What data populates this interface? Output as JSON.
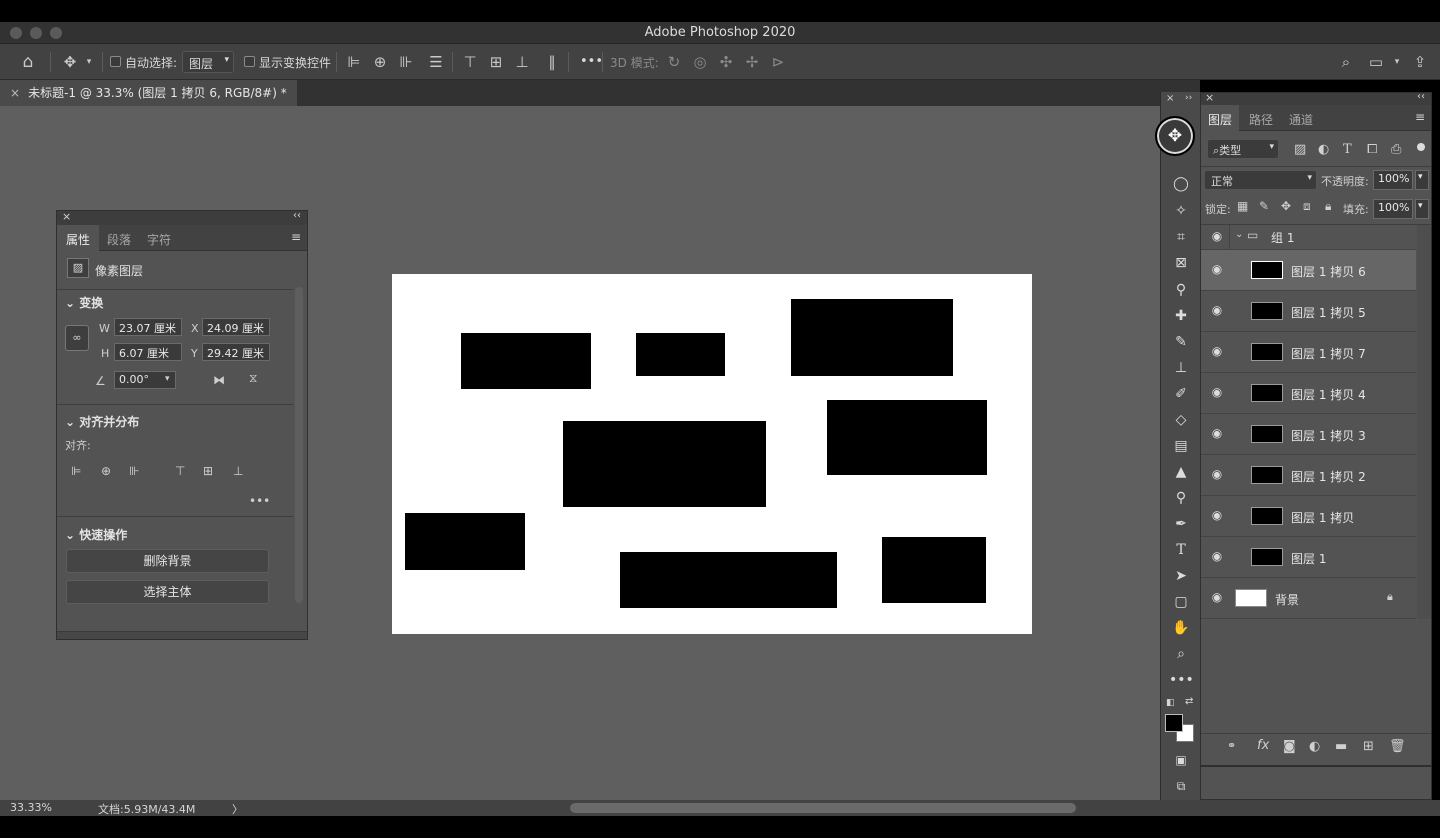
{
  "window": {
    "title": "Adobe Photoshop 2020"
  },
  "options_bar": {
    "auto_select_label": "自动选择:",
    "auto_select_value": "图层",
    "show_transform_label": "显示变换控件",
    "more_label": "•••",
    "mode_3d_label": "3D 模式:"
  },
  "document_tab": {
    "title": "未标题-1 @ 33.3% (图层 1 拷贝 6, RGB/8#) *"
  },
  "properties_panel": {
    "tabs": [
      "属性",
      "段落",
      "字符"
    ],
    "layer_type": "像素图层",
    "transform": {
      "heading": "变换",
      "w_label": "W",
      "w_value": "23.07 厘米",
      "x_label": "X",
      "x_value": "24.09 厘米",
      "h_label": "H",
      "h_value": "6.07 厘米",
      "y_label": "Y",
      "y_value": "29.42 厘米",
      "angle_value": "0.00°"
    },
    "align": {
      "heading": "对齐并分布",
      "align_label": "对齐:",
      "more": "•••"
    },
    "quick_actions": {
      "heading": "快速操作",
      "remove_bg": "删除背景",
      "select_subject": "选择主体"
    }
  },
  "layers_panel": {
    "tabs": [
      "图层",
      "路径",
      "通道"
    ],
    "filter_label": "类型",
    "blend_mode": "正常",
    "opacity_label": "不透明度:",
    "opacity_value": "100%",
    "lock_label": "锁定:",
    "fill_label": "填充:",
    "fill_value": "100%",
    "group_name": "组 1",
    "layers": [
      "图层 1 拷贝 6",
      "图层 1 拷贝 5",
      "图层 1 拷贝 7",
      "图层 1 拷贝 4",
      "图层 1 拷贝 3",
      "图层 1 拷贝 2",
      "图层 1 拷贝",
      "图层 1"
    ],
    "background_layer": "背景"
  },
  "status_bar": {
    "zoom": "33.33%",
    "doc_info": "文档:5.93M/43.4M",
    "arrow": "〉"
  },
  "colors": {
    "workspace": "#5f5f5f",
    "panel": "#535353",
    "foreground": "#000000",
    "background": "#ffffff"
  }
}
